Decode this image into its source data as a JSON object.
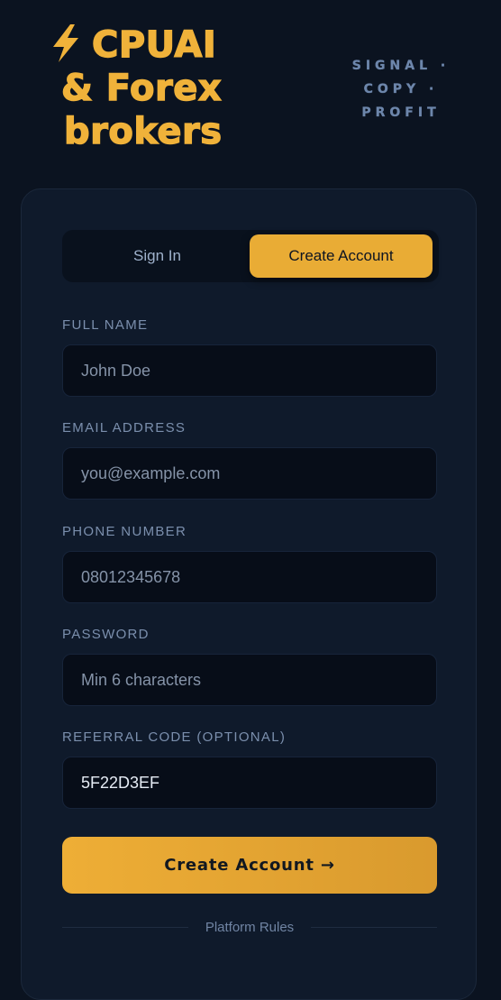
{
  "brand": {
    "line1": "CPUAI",
    "line2": "& Forex",
    "line3": "brokers",
    "icon": "lightning-bolt-icon",
    "color": "#f0b23a"
  },
  "tagline": {
    "line1": "SIGNAL ·",
    "line2": "COPY ·",
    "line3": "PROFIT"
  },
  "tabs": {
    "sign_in": "Sign In",
    "create_account": "Create Account",
    "active": "create_account"
  },
  "form": {
    "full_name": {
      "label": "FULL NAME",
      "placeholder": "John Doe",
      "value": ""
    },
    "email": {
      "label": "EMAIL ADDRESS",
      "placeholder": "you@example.com",
      "value": ""
    },
    "phone": {
      "label": "PHONE NUMBER",
      "placeholder": "08012345678",
      "value": ""
    },
    "password": {
      "label": "PASSWORD",
      "placeholder": "Min 6 characters",
      "value": ""
    },
    "referral": {
      "label": "REFERRAL CODE (OPTIONAL)",
      "placeholder": "",
      "value": "5F22D3EF"
    }
  },
  "submit": {
    "label": "Create Account →"
  },
  "divider": {
    "label": "Platform Rules"
  },
  "colors": {
    "accent": "#e9ac35",
    "background": "#0b1320",
    "card": "#0f1a2b",
    "input": "#070d18"
  }
}
